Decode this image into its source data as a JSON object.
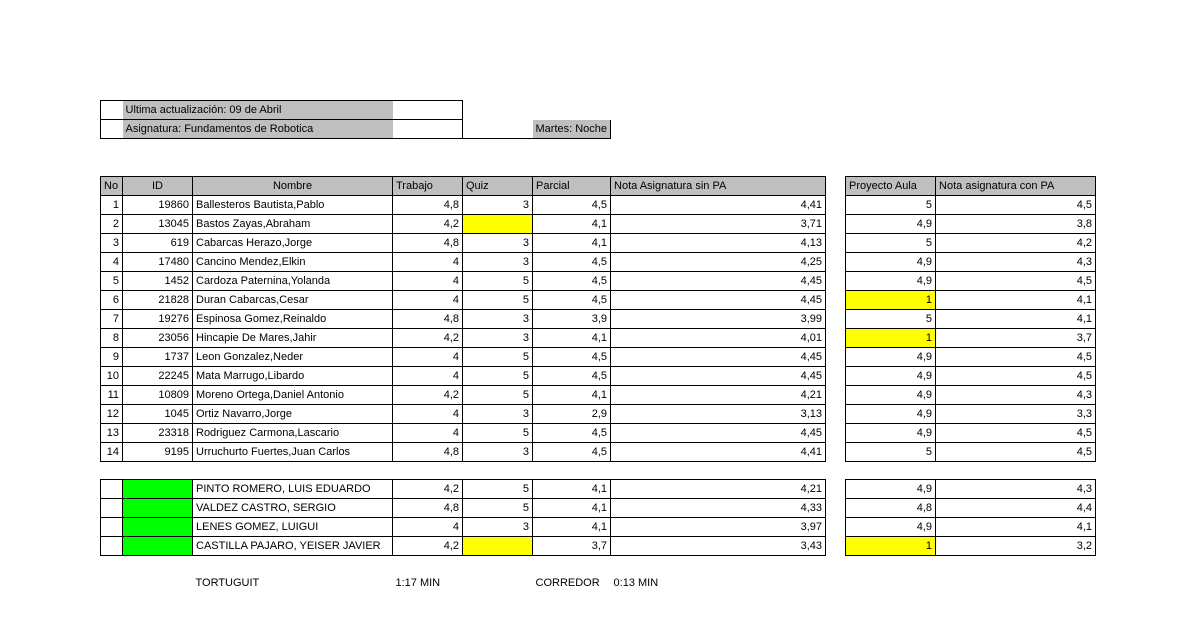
{
  "meta": {
    "lastUpdate": "Ultima actualización: 09 de Abril",
    "subject": "Asignatura: Fundamentos de Robotica",
    "schedule": "Martes: Noche"
  },
  "headers": {
    "no": "No",
    "id": "ID",
    "nombre": "Nombre",
    "trabajo": "Trabajo",
    "quiz": "Quiz",
    "parcial": "Parcial",
    "notaSinPA": "Nota Asignatura sin PA",
    "proyecto": "Proyecto Aula",
    "notaConPA": "Nota asignatura con PA"
  },
  "rows": [
    {
      "no": "1",
      "id": "19860",
      "name": "Ballesteros Bautista,Pablo",
      "trabajo": "4,8",
      "quiz": "3",
      "parcial": "4,5",
      "notaSin": "4,41",
      "proy": "5",
      "notaCon": "4,5",
      "quizYellow": false,
      "proyYellow": false
    },
    {
      "no": "2",
      "id": "13045",
      "name": "Bastos Zayas,Abraham",
      "trabajo": "4,2",
      "quiz": "",
      "parcial": "4,1",
      "notaSin": "3,71",
      "proy": "4,9",
      "notaCon": "3,8",
      "quizYellow": true,
      "proyYellow": false
    },
    {
      "no": "3",
      "id": "619",
      "name": "Cabarcas Herazo,Jorge",
      "trabajo": "4,8",
      "quiz": "3",
      "parcial": "4,1",
      "notaSin": "4,13",
      "proy": "5",
      "notaCon": "4,2",
      "quizYellow": false,
      "proyYellow": false
    },
    {
      "no": "4",
      "id": "17480",
      "name": "Cancino Mendez,Elkin",
      "trabajo": "4",
      "quiz": "3",
      "parcial": "4,5",
      "notaSin": "4,25",
      "proy": "4,9",
      "notaCon": "4,3",
      "quizYellow": false,
      "proyYellow": false
    },
    {
      "no": "5",
      "id": "1452",
      "name": "Cardoza Paternina,Yolanda",
      "trabajo": "4",
      "quiz": "5",
      "parcial": "4,5",
      "notaSin": "4,45",
      "proy": "4,9",
      "notaCon": "4,5",
      "quizYellow": false,
      "proyYellow": false
    },
    {
      "no": "6",
      "id": "21828",
      "name": "Duran Cabarcas,Cesar",
      "trabajo": "4",
      "quiz": "5",
      "parcial": "4,5",
      "notaSin": "4,45",
      "proy": "1",
      "notaCon": "4,1",
      "quizYellow": false,
      "proyYellow": true
    },
    {
      "no": "7",
      "id": "19276",
      "name": "Espinosa Gomez,Reinaldo",
      "trabajo": "4,8",
      "quiz": "3",
      "parcial": "3,9",
      "notaSin": "3,99",
      "proy": "5",
      "notaCon": "4,1",
      "quizYellow": false,
      "proyYellow": false
    },
    {
      "no": "8",
      "id": "23056",
      "name": "Hincapie De Mares,Jahir",
      "trabajo": "4,2",
      "quiz": "3",
      "parcial": "4,1",
      "notaSin": "4,01",
      "proy": "1",
      "notaCon": "3,7",
      "quizYellow": false,
      "proyYellow": true
    },
    {
      "no": "9",
      "id": "1737",
      "name": "Leon Gonzalez,Neder",
      "trabajo": "4",
      "quiz": "5",
      "parcial": "4,5",
      "notaSin": "4,45",
      "proy": "4,9",
      "notaCon": "4,5",
      "quizYellow": false,
      "proyYellow": false
    },
    {
      "no": "10",
      "id": "22245",
      "name": "Mata Marrugo,Libardo",
      "trabajo": "4",
      "quiz": "5",
      "parcial": "4,5",
      "notaSin": "4,45",
      "proy": "4,9",
      "notaCon": "4,5",
      "quizYellow": false,
      "proyYellow": false
    },
    {
      "no": "11",
      "id": "10809",
      "name": "Moreno Ortega,Daniel Antonio",
      "trabajo": "4,2",
      "quiz": "5",
      "parcial": "4,1",
      "notaSin": "4,21",
      "proy": "4,9",
      "notaCon": "4,3",
      "quizYellow": false,
      "proyYellow": false
    },
    {
      "no": "12",
      "id": "1045",
      "name": "Ortiz Navarro,Jorge",
      "trabajo": "4",
      "quiz": "3",
      "parcial": "2,9",
      "notaSin": "3,13",
      "proy": "4,9",
      "notaCon": "3,3",
      "quizYellow": false,
      "proyYellow": false
    },
    {
      "no": "13",
      "id": "23318",
      "name": "Rodriguez Carmona,Lascario",
      "trabajo": "4",
      "quiz": "5",
      "parcial": "4,5",
      "notaSin": "4,45",
      "proy": "4,9",
      "notaCon": "4,5",
      "quizYellow": false,
      "proyYellow": false
    },
    {
      "no": "14",
      "id": "9195",
      "name": "Urruchurto Fuertes,Juan Carlos",
      "trabajo": "4,8",
      "quiz": "3",
      "parcial": "4,5",
      "notaSin": "4,41",
      "proy": "5",
      "notaCon": "4,5",
      "quizYellow": false,
      "proyYellow": false
    }
  ],
  "extraRows": [
    {
      "name": "PINTO ROMERO, LUIS EDUARDO",
      "trabajo": "4,2",
      "quiz": "5",
      "parcial": "4,1",
      "notaSin": "4,21",
      "proy": "4,9",
      "notaCon": "4,3",
      "quizYellow": false,
      "proyYellow": false
    },
    {
      "name": "VALDEZ CASTRO, SERGIO",
      "trabajo": "4,8",
      "quiz": "5",
      "parcial": "4,1",
      "notaSin": "4,33",
      "proy": "4,8",
      "notaCon": "4,4",
      "quizYellow": false,
      "proyYellow": false
    },
    {
      "name": "LENES GOMEZ, LUIGUI",
      "trabajo": "4",
      "quiz": "3",
      "parcial": "4,1",
      "notaSin": "3,97",
      "proy": "4,9",
      "notaCon": "4,1",
      "quizYellow": false,
      "proyYellow": false
    },
    {
      "name": "CASTILLA PAJARO, YEISER JAVIER",
      "trabajo": "4,2",
      "quiz": "",
      "parcial": "3,7",
      "notaSin": "3,43",
      "proy": "1",
      "notaCon": "3,2",
      "quizYellow": true,
      "proyYellow": true
    }
  ],
  "footer": {
    "left1": "TORTUGUIT",
    "left2": "1:17 MIN",
    "right1": "CORREDOR",
    "right2": "0:13 MIN"
  }
}
